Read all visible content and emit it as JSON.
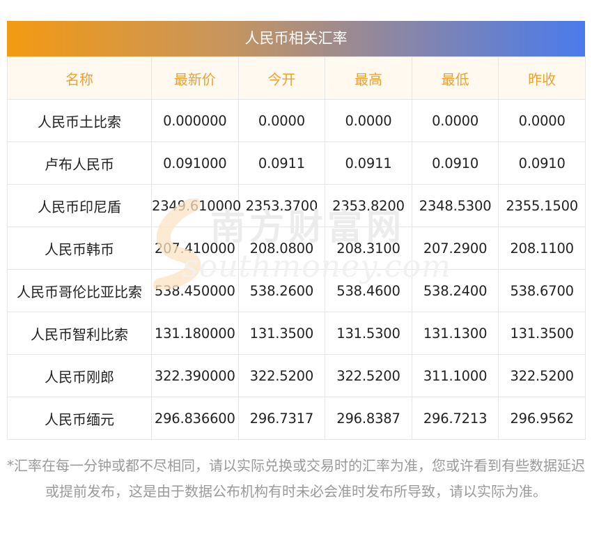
{
  "title": "人民币相关汇率",
  "headers": [
    "名称",
    "最新价",
    "今开",
    "最高",
    "最低",
    "昨收"
  ],
  "rows": [
    {
      "name": "人民币土比索",
      "latest": "0.000000",
      "open": "0.0000",
      "high": "0.0000",
      "low": "0.0000",
      "prev_close": "0.0000"
    },
    {
      "name": "卢布人民币",
      "latest": "0.091000",
      "open": "0.0911",
      "high": "0.0911",
      "low": "0.0910",
      "prev_close": "0.0910"
    },
    {
      "name": "人民币印尼盾",
      "latest": "2349.610000",
      "open": "2353.3700",
      "high": "2353.8200",
      "low": "2348.5300",
      "prev_close": "2355.1500"
    },
    {
      "name": "人民币韩币",
      "latest": "207.410000",
      "open": "208.0800",
      "high": "208.3100",
      "low": "207.2900",
      "prev_close": "208.1100"
    },
    {
      "name": "人民币哥伦比亚比索",
      "latest": "538.450000",
      "open": "538.2600",
      "high": "538.4600",
      "low": "538.2400",
      "prev_close": "538.6700"
    },
    {
      "name": "人民币智利比索",
      "latest": "131.180000",
      "open": "131.3500",
      "high": "131.5300",
      "low": "131.1300",
      "prev_close": "131.3500"
    },
    {
      "name": "人民币刚郎",
      "latest": "322.390000",
      "open": "322.5200",
      "high": "322.5200",
      "low": "311.1000",
      "prev_close": "322.5200"
    },
    {
      "name": "人民币缅元",
      "latest": "296.836600",
      "open": "296.7317",
      "high": "296.8387",
      "low": "296.7213",
      "prev_close": "296.9562"
    }
  ],
  "watermark": {
    "cn_text": "南方财富网",
    "en_text": "southmoney.com"
  },
  "note": "*汇率在每一分钟或都不尽相同，请以实际兑换或交易时的汇率为准，您或许看到有些数据延迟或提前发布，这是由于数据公布机构有时未必会准时发布所导致，请以实际为准。",
  "colors": {
    "banner_start": "#f39a12",
    "banner_end": "#4a7bec",
    "header_text": "#f0a030",
    "header_bg": "#fff9ef",
    "note_text": "#9a9a9a"
  }
}
